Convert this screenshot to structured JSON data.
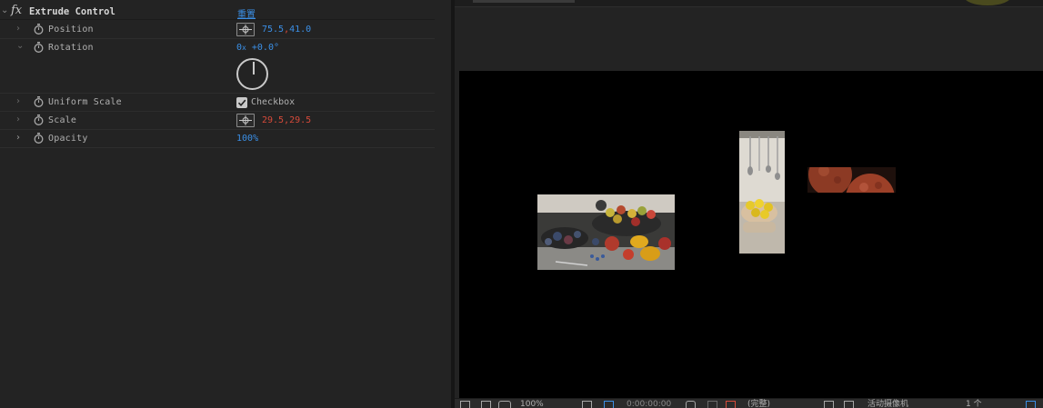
{
  "effect": {
    "fx_mark": "fx",
    "name": "Extrude Control",
    "reset_label": "重置"
  },
  "properties": {
    "position": {
      "label": "Position",
      "x": "75.5",
      "sep": ",",
      "y": "41.0"
    },
    "rotation": {
      "label": "Rotation",
      "revolutions": "0",
      "x_mark": "x",
      "degrees": "+0.0°"
    },
    "uniform_scale": {
      "label": "Uniform Scale",
      "checkbox_label": "Checkbox",
      "checked": true
    },
    "scale": {
      "label": "Scale",
      "x": "29.5",
      "sep": ",",
      "y": "29.5"
    },
    "opacity": {
      "label": "Opacity",
      "value": "100",
      "unit": "%"
    }
  },
  "viewer": {
    "bottom_bar": {
      "zoom": "100%",
      "timecode": "0:00:00:00",
      "resolution": "(完整)",
      "camera": "活动摄像机",
      "views": "1 个"
    }
  },
  "colors": {
    "value_blue": "#3b8fe6",
    "value_red": "#d64a3a",
    "panel_bg": "#232323",
    "canvas_bg": "#000000"
  }
}
